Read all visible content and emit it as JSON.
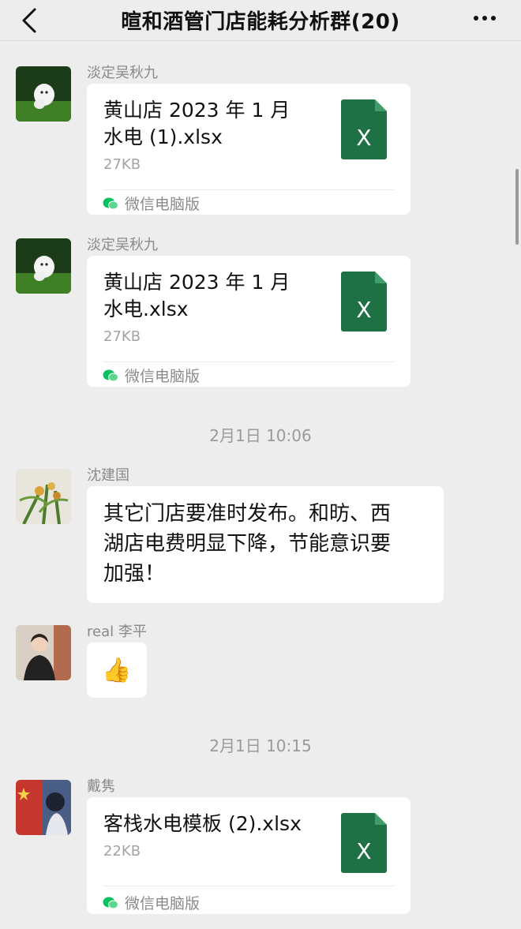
{
  "header": {
    "title": "暄和酒管门店能耗分析群(20)"
  },
  "messages": {
    "m1": {
      "sender": "淡定吴秋九",
      "file_name_line1": "黄山店 2023 年 1 月",
      "file_name_line2": "水电 (1).xlsx",
      "file_size": "27KB",
      "source": "微信电脑版"
    },
    "m2": {
      "sender": "淡定吴秋九",
      "file_name_line1": "黄山店 2023 年 1 月",
      "file_name_line2": "水电.xlsx",
      "file_size": "27KB",
      "source": "微信电脑版"
    },
    "t1": "2月1日 10:06",
    "m3": {
      "sender": "沈建国",
      "text_line1": "其它门店要准时发布。和昉、西",
      "text_line2": "湖店电费明显下降，节能意识要",
      "text_line3": "加强！"
    },
    "m4": {
      "sender": "real 李平",
      "emoji": "👍"
    },
    "t2": "2月1日 10:15",
    "m5": {
      "sender": "戴隽",
      "file_name_line1": "客栈水电模板 (2).xlsx",
      "file_size": "22KB",
      "source": "微信电脑版"
    }
  },
  "icons": {
    "back": "chevron-left-icon",
    "more": "more-dots-icon",
    "file": "excel-file-icon",
    "source": "wechat-icon"
  },
  "colors": {
    "excel_green": "#1e7145",
    "wechat_green": "#07c160",
    "background": "#ededed"
  }
}
